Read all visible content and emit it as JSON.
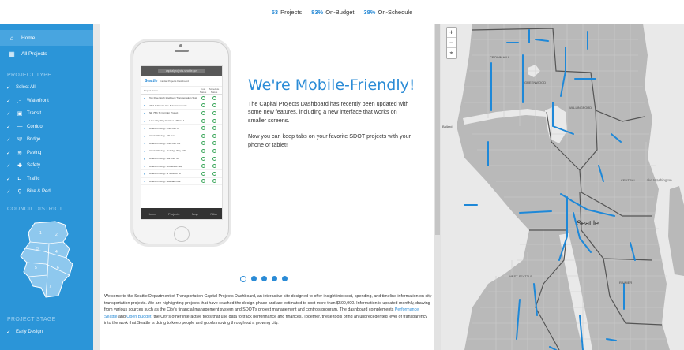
{
  "stats": {
    "projects_value": "53",
    "projects_label": "Projects",
    "budget_value": "83%",
    "budget_label": "On-Budget",
    "schedule_value": "38%",
    "schedule_label": "On-Schedule"
  },
  "sidebar": {
    "home": "Home",
    "all_projects": "All Projects",
    "project_type_heading": "PROJECT TYPE",
    "types": [
      {
        "label": "Select All",
        "icon": ""
      },
      {
        "label": "Waterfront",
        "icon": "waterfront-icon"
      },
      {
        "label": "Transit",
        "icon": "transit-icon"
      },
      {
        "label": "Corridor",
        "icon": "corridor-icon"
      },
      {
        "label": "Bridge",
        "icon": "bridge-icon"
      },
      {
        "label": "Paving",
        "icon": "paving-icon"
      },
      {
        "label": "Safety",
        "icon": "safety-icon"
      },
      {
        "label": "Traffic",
        "icon": "traffic-icon"
      },
      {
        "label": "Bike & Ped",
        "icon": "bike-ped-icon"
      }
    ],
    "council_district_heading": "COUNCIL DISTRICT",
    "districts": [
      "1",
      "2",
      "3",
      "4",
      "5",
      "6",
      "7"
    ],
    "project_stage_heading": "PROJECT STAGE",
    "stages": [
      "Early Design"
    ]
  },
  "promo": {
    "title": "We're Mobile-Friendly!",
    "para1": "The Capital Projects Dashboard has recently been updated with some new features, including a new interface that works on smaller screens.",
    "para2": "Now you can keep tabs on your favorite SDOT projects with your phone or tablet!"
  },
  "phone": {
    "url": "capitalprojects.seattle.gov",
    "logo": "Seattle",
    "dashboard_title": "Capital Projects Dashboard",
    "col_project": "Project Name",
    "col_cost": "Cost Status",
    "col_schedule": "Schedule Status",
    "rows": [
      "Top Rise North Intelligent Transportation System (ITS)",
      "23rd & Rainier Ave S Improvements",
      "NE 75th St Corridor Project",
      "Lake City Way Corridor - Phase 1",
      "Arterial Paving - 15th Ave S",
      "Arterial Paving - 5th Ave",
      "Arterial Paving - 35th Ave SW",
      "Arterial Paving - Delridge Way SW",
      "Arterial Paving - NE 65th St",
      "Arterial Paving - Roosevelt Way",
      "Arterial Paving - S Jackson St",
      "Arterial Paving - Eastlake Ave"
    ],
    "tabs": [
      "Home",
      "Projects",
      "Map",
      "Filter"
    ]
  },
  "carousel": {
    "count": 5,
    "active": 0
  },
  "welcome": {
    "part1": "Welcome to the Seattle Department of Transportation Capital Projects Dashboard, an interactive site designed to offer insight into cost, spending, and timeline information on city transportation projects. We are highlighting projects that have reached the design phase and are estimated to cost more than $500,000. Information is updated monthly, drawing from various sources such as the City's financial management system and SDOT's project management and controls program. The dashboard complements ",
    "link1": "Performance Seattle",
    "and": " and ",
    "link2": "Open Budget",
    "part2": ", the City's other interactive tools that use data to track performance and finances. Together, these tools bring an unprecedented level of transparency into the work that Seattle is doing to keep people and goods moving throughout a growing city."
  },
  "map": {
    "zoom_in": "+",
    "zoom_out": "−",
    "locate": "⌖",
    "labels": {
      "city": "Seattle",
      "lake": "Lake Washington",
      "ballard": "Ballard",
      "crown_hill": "CROWN HILL",
      "greenwood": "GREENWOOD",
      "wallingford": "WALLINGFORD",
      "central": "CENTRAL",
      "rainier": "RAINIER",
      "west_seattle": "WEST SEATTLE"
    }
  },
  "colors": {
    "accent": "#2a8bd6",
    "sidebar": "#2b95d8",
    "map_land": "#b9b9b9",
    "map_water": "#e9e9e9",
    "route": "#1e88d8"
  }
}
